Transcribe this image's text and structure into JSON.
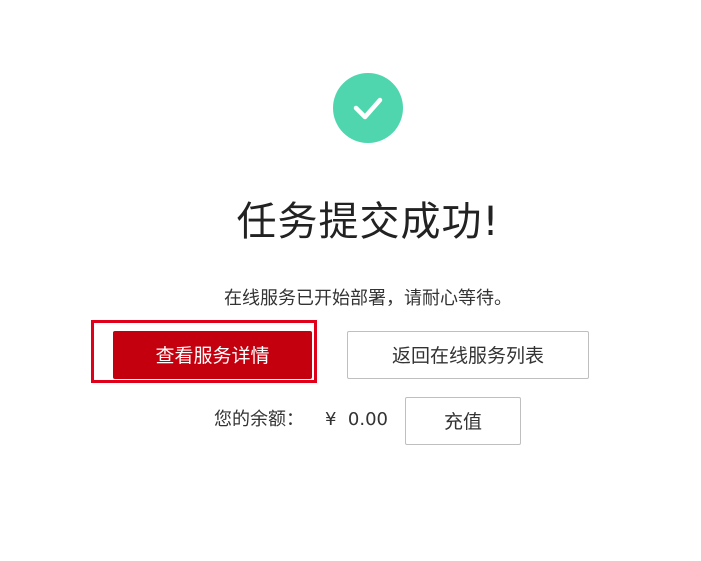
{
  "result": {
    "icon": "check-circle-icon",
    "icon_color": "#4fd6ae",
    "title": "任务提交成功!",
    "subtitle": "在线服务已开始部署，请耐心等待。"
  },
  "actions": {
    "view_details_label": "查看服务详情",
    "back_to_list_label": "返回在线服务列表",
    "primary_color": "#c4000f",
    "highlight_color": "#e0001a"
  },
  "balance": {
    "label": "您的余额：",
    "currency_symbol": "¥",
    "amount": "0.00",
    "recharge_label": "充值"
  }
}
